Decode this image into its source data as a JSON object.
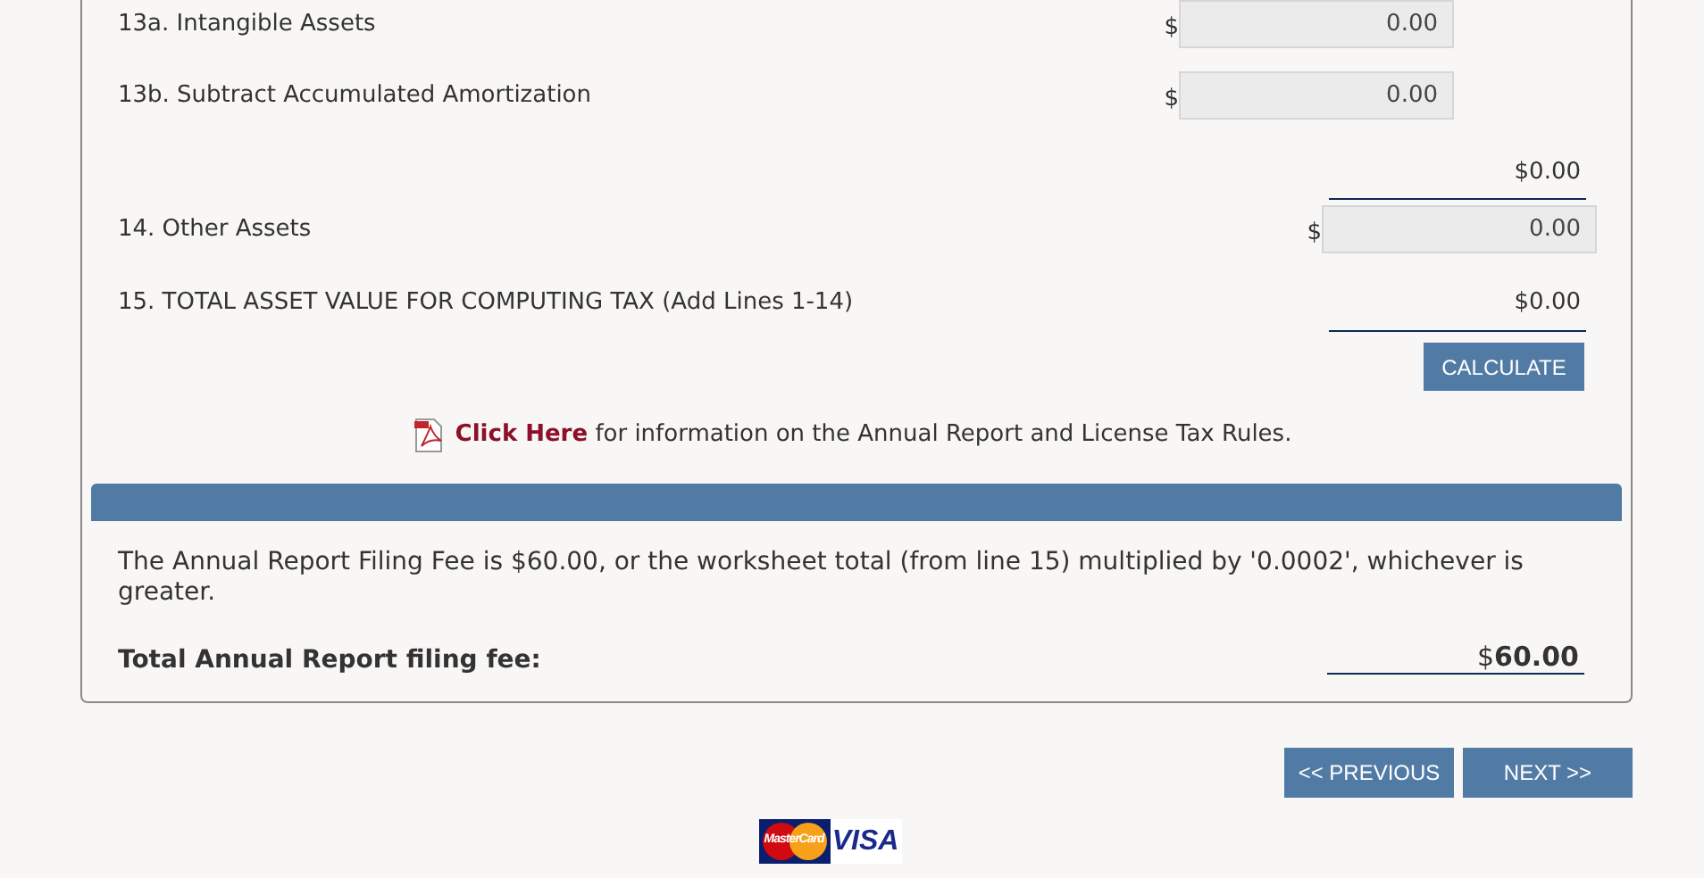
{
  "rows": [
    {
      "kind": "inner_input",
      "label": "13a. Intangible Assets",
      "currency": "$",
      "value": "0.00"
    },
    {
      "kind": "inner_input",
      "label": "13b. Subtract Accumulated Amortization",
      "currency": "$",
      "value": "0.00"
    },
    {
      "kind": "total",
      "value": "$0.00"
    },
    {
      "kind": "outer_input",
      "label": "14. Other Assets",
      "currency": "$",
      "value": "0.00"
    },
    {
      "kind": "total",
      "label": "15. TOTAL ASSET VALUE FOR COMPUTING TAX (Add Lines 1-14)",
      "value": "$0.00"
    }
  ],
  "calculate_button": "CALCULATE",
  "info": {
    "link": "Click Here",
    "text": "for information on the Annual Report and License Tax Rules."
  },
  "fee_note": "The Annual Report Filing Fee is $60.00, or the worksheet total (from line 15) multiplied by '0.0002', whichever is greater.",
  "fee_total": {
    "label": "Total Annual Report filing fee:",
    "currency": "$",
    "value": "60.00"
  },
  "nav": {
    "previous": "<< PREVIOUS",
    "next": "NEXT >>"
  },
  "cards": {
    "mastercard": "MasterCard",
    "visa": "VISA"
  }
}
